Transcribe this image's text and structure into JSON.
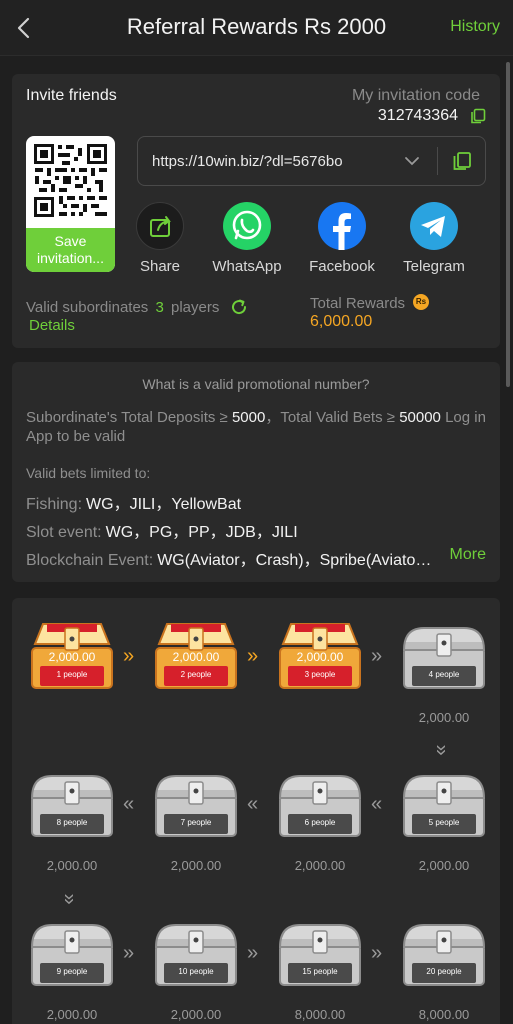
{
  "header": {
    "title": "Referral Rewards Rs 2000",
    "history_label": "History"
  },
  "invite": {
    "title": "Invite friends",
    "code_label": "My invitation code",
    "code": "312743364",
    "save_label": "Save invitation...",
    "link": "https://10win.biz/?dl=5676bo",
    "share_options": [
      "Share",
      "WhatsApp",
      "Facebook",
      "Telegram"
    ],
    "subordinates_label": "Valid subordinates",
    "subordinates_count": "3",
    "subordinates_unit": "players",
    "details_label": "Details",
    "total_rewards_label": "Total Rewards",
    "currency_badge": "Rs",
    "total_rewards": "6,000.00"
  },
  "promo": {
    "question": "What is a valid promotional number?",
    "rule_deposit_label": "Subordinate's Total Deposits ≥",
    "rule_deposit_value": "5000",
    "rule_bets_label": "，Total Valid Bets ≥",
    "rule_bets_value": "50000",
    "rule_suffix": "Log in App to be valid",
    "limit_label": "Valid bets limited to:",
    "bets": [
      {
        "category": "Fishing:",
        "games": "WG，JILI，YellowBat"
      },
      {
        "category": "Slot event:",
        "games": "WG，PG，PP，JDB，JILI"
      },
      {
        "category": "Blockchain Event:",
        "games": "WG(Aviator，Crash)，Spribe(Aviator…"
      }
    ],
    "more_label": "More"
  },
  "rewards": {
    "chests": [
      {
        "people": "1 people",
        "amount": "2,000.00",
        "opened": true
      },
      {
        "people": "2 people",
        "amount": "2,000.00",
        "opened": true
      },
      {
        "people": "3 people",
        "amount": "2,000.00",
        "opened": true
      },
      {
        "people": "4 people",
        "amount": "2,000.00",
        "opened": false
      },
      {
        "people": "5 people",
        "amount": "2,000.00",
        "opened": false
      },
      {
        "people": "6 people",
        "amount": "2,000.00",
        "opened": false
      },
      {
        "people": "7 people",
        "amount": "2,000.00",
        "opened": false
      },
      {
        "people": "8 people",
        "amount": "2,000.00",
        "opened": false
      },
      {
        "people": "9 people",
        "amount": "2,000.00",
        "opened": false
      },
      {
        "people": "10 people",
        "amount": "2,000.00",
        "opened": false
      },
      {
        "people": "15 people",
        "amount": "8,000.00",
        "opened": false
      },
      {
        "people": "20 people",
        "amount": "8,000.00",
        "opened": false
      }
    ]
  },
  "colors": {
    "accent": "#6fcf3a",
    "gold": "#f5a623",
    "background": "#1f1f1f",
    "card": "#2a2a2a"
  }
}
